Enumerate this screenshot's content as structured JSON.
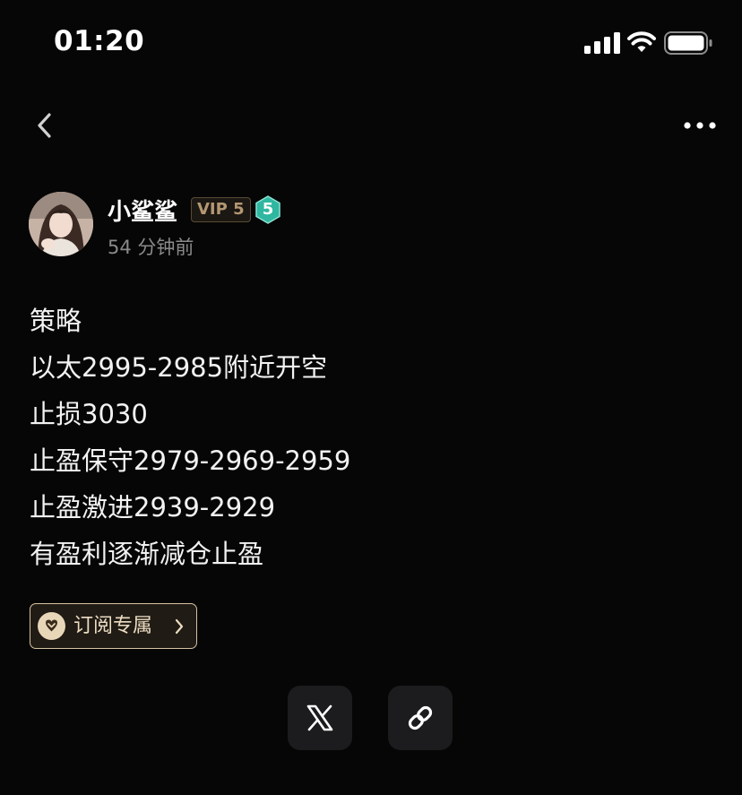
{
  "status_bar": {
    "time": "01:20",
    "icons": [
      "cellular-signal-icon",
      "wifi-icon",
      "battery-icon"
    ]
  },
  "nav": {
    "back_icon": "chevron-left-icon",
    "more_icon": "more-horizontal-icon"
  },
  "author": {
    "name": "小鲨鲨",
    "vip_label": "VIP 5",
    "level": "5",
    "post_time": "54 分钟前"
  },
  "post": {
    "lines": [
      "策略",
      "以太2995-2985附近开空",
      "止损3030",
      "止盈保守2979-2969-2959",
      "止盈激进2939-2929",
      "有盈利逐渐减仓止盈"
    ]
  },
  "subscribe": {
    "label": "订阅专属",
    "icon": "heart-badge-icon"
  },
  "share": {
    "buttons": [
      "x-logo-icon",
      "link-icon"
    ]
  },
  "colors": {
    "background": "#060606",
    "vip_gold": "#b49773",
    "level_badge_green": "#2fb7a1",
    "subscribe_border": "#d6c2a3",
    "share_button_bg": "#1c1c1e"
  }
}
